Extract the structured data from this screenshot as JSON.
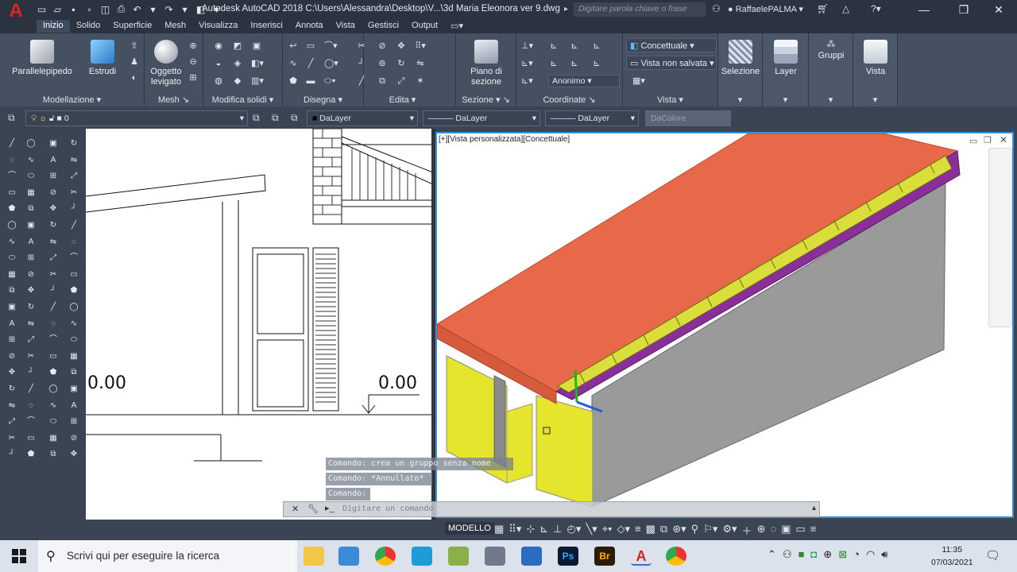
{
  "app": {
    "logo": "A",
    "title": "Autodesk AutoCAD 2018   C:\\Users\\Alessandra\\Desktop\\V...\\3d Maria Eleonora ver 9.dwg",
    "search_placeholder": "Digitare parola chiave o frase",
    "user": "RaffaelePALMA"
  },
  "tabs": [
    "Inizio",
    "Solido",
    "Superficie",
    "Mesh",
    "Visualizza",
    "Inserisci",
    "Annota",
    "Vista",
    "Gestisci",
    "Output"
  ],
  "ribbon": {
    "big": {
      "box": "Parallelepipedo",
      "extrude": "Estrudi",
      "smooth": "Oggetto levigato",
      "section_plane": "Piano di sezione",
      "selection": "Selezione",
      "layer": "Layer",
      "groups": "Gruppi",
      "view": "Vista"
    },
    "panels": {
      "modeling": "Modellazione",
      "mesh": "Mesh",
      "edit_solids": "Modifica solidi",
      "draw": "Disegna",
      "edit": "Edita",
      "section": "Sezione",
      "coordinates": "Coordinate",
      "view": "Vista"
    },
    "visual_style": "Concettuale",
    "saved_view": "Vista non salvata",
    "ucs": "Anonimo"
  },
  "props": {
    "layer": "0",
    "color": "DaLayer",
    "linetype": "DaLayer",
    "lineweight": "DaLayer",
    "plotstyle": "DaColore"
  },
  "viewport": {
    "label": "[+][Vista personalizzata][Concettuale]",
    "elev_left": "0.00",
    "elev_right": "0.00"
  },
  "command": {
    "line1": "Comando: crea un gruppo senza nome",
    "line2": "Comando: *Annullato*",
    "line3": "Comando:",
    "placeholder": "Digitare un comando"
  },
  "status": {
    "modello": "MODELLO"
  },
  "taskbar": {
    "search": "Scrivi qui per eseguire la ricerca",
    "time": "11:35",
    "date": "07/03/2021"
  },
  "colors": {
    "roof": "#e8694a",
    "fascia": "#8a2f9a",
    "tiles": "#d9de3a",
    "wall": "#9a9a9a",
    "yellow": "#e6e52e",
    "accent": "#3d8fd6"
  }
}
